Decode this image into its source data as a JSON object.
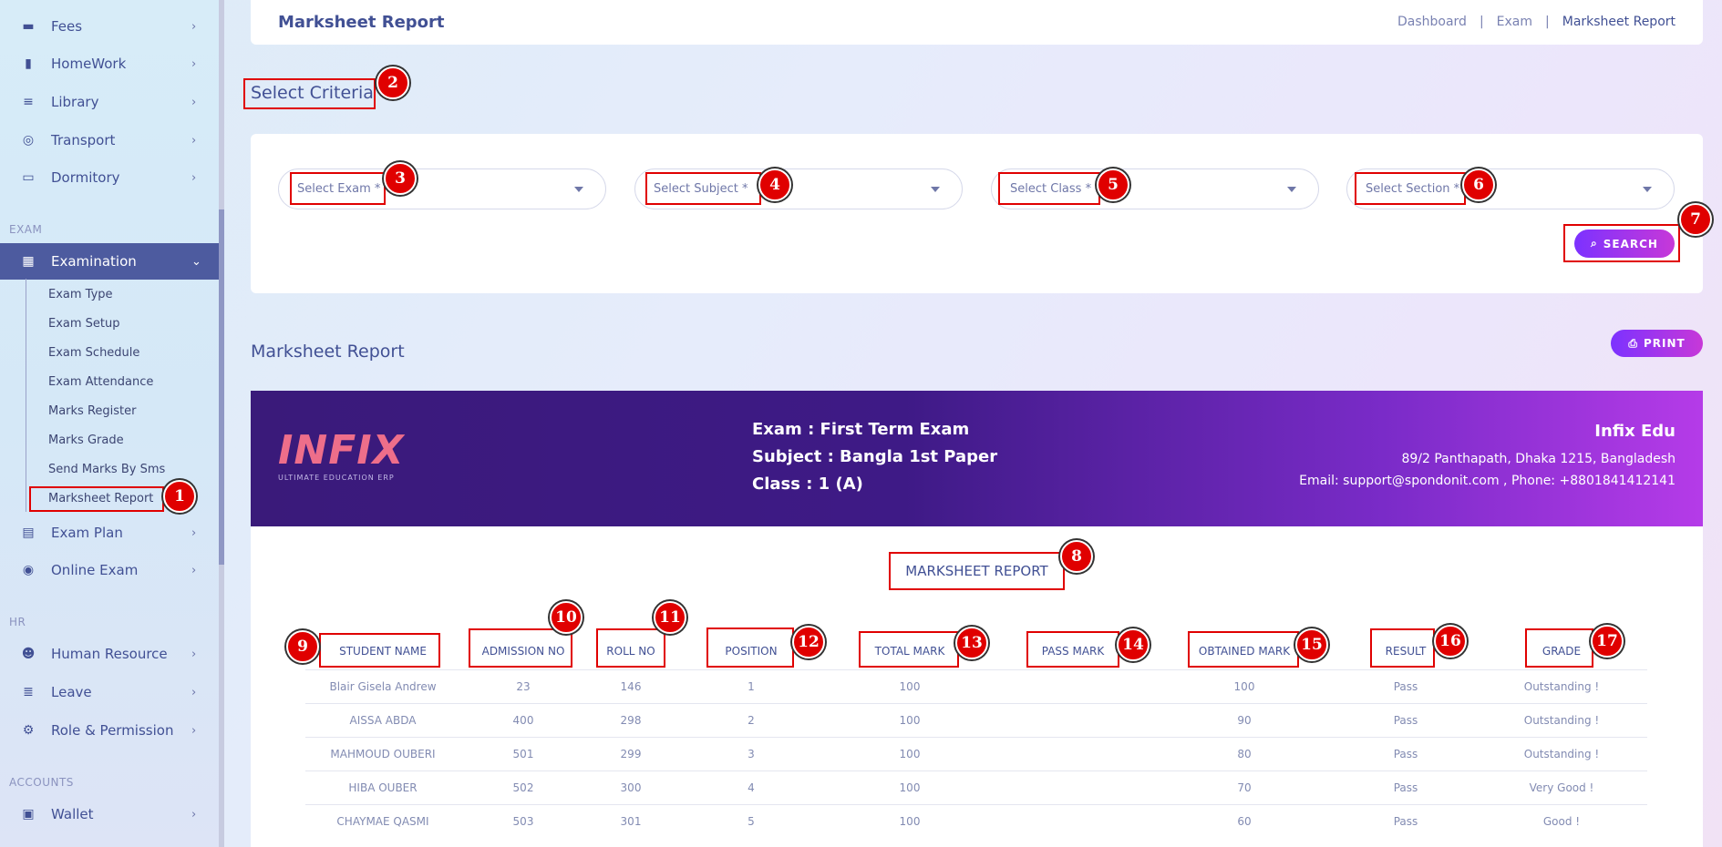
{
  "sidebar": {
    "top_items": [
      {
        "label": "Fees",
        "icon": "money-icon"
      },
      {
        "label": "HomeWork",
        "icon": "book-icon"
      },
      {
        "label": "Library",
        "icon": "library-icon"
      },
      {
        "label": "Transport",
        "icon": "bus-icon"
      },
      {
        "label": "Dormitory",
        "icon": "bed-icon"
      }
    ],
    "sections": {
      "exam": "EXAM",
      "hr": "HR",
      "accounts": "ACCOUNTS"
    },
    "examination": "Examination",
    "exam_sub": [
      "Exam Type",
      "Exam Setup",
      "Exam Schedule",
      "Exam Attendance",
      "Marks Register",
      "Marks Grade",
      "Send Marks By Sms",
      "Marksheet Report"
    ],
    "exam_plan": "Exam Plan",
    "online_exam": "Online Exam",
    "hr_items": [
      "Human Resource",
      "Leave",
      "Role & Permission"
    ],
    "wallet": "Wallet"
  },
  "header": {
    "title": "Marksheet Report",
    "breadcrumb": [
      "Dashboard",
      "|",
      "Exam",
      "|",
      "Marksheet Report"
    ]
  },
  "criteria": {
    "title": "Select Criteria",
    "selects": [
      "Select Exam *",
      "Select Subject *",
      "Select Class *",
      "Select Section *"
    ],
    "search_label": "SEARCH"
  },
  "report": {
    "title": "Marksheet Report",
    "print_label": "PRINT",
    "logo": "INFIX",
    "logo_sub": "ULTIMATE EDUCATION ERP",
    "exam": "Exam : First Term Exam",
    "subject": "Subject : Bangla 1st Paper",
    "class": "Class : 1 (A)",
    "school_name": "Infix Edu",
    "address": "89/2 Panthapath, Dhaka 1215, Bangladesh",
    "contact": "Email: support@spondonit.com , Phone: +8801841412141",
    "heading": "MARKSHEET REPORT"
  },
  "table": {
    "columns": [
      "STUDENT NAME",
      "ADMISSION NO",
      "ROLL NO",
      "POSITION",
      "TOTAL MARK",
      "PASS MARK",
      "OBTAINED MARK",
      "RESULT",
      "GRADE"
    ],
    "rows": [
      [
        "Blair Gisela Andrew",
        "23",
        "146",
        "1",
        "100",
        "",
        "100",
        "Pass",
        "Outstanding !"
      ],
      [
        "AISSA ABDA",
        "400",
        "298",
        "2",
        "100",
        "",
        "90",
        "Pass",
        "Outstanding !"
      ],
      [
        "MAHMOUD OUBERI",
        "501",
        "299",
        "3",
        "100",
        "",
        "80",
        "Pass",
        "Outstanding !"
      ],
      [
        "HIBA OUBER",
        "502",
        "300",
        "4",
        "100",
        "",
        "70",
        "Pass",
        "Very Good !"
      ],
      [
        "CHAYMAE QASMI",
        "503",
        "301",
        "5",
        "100",
        "",
        "60",
        "Pass",
        "Good !"
      ]
    ]
  },
  "annotations": [
    "1",
    "2",
    "3",
    "4",
    "5",
    "6",
    "7",
    "8",
    "9",
    "10",
    "11",
    "12",
    "13",
    "14",
    "15",
    "16",
    "17"
  ]
}
